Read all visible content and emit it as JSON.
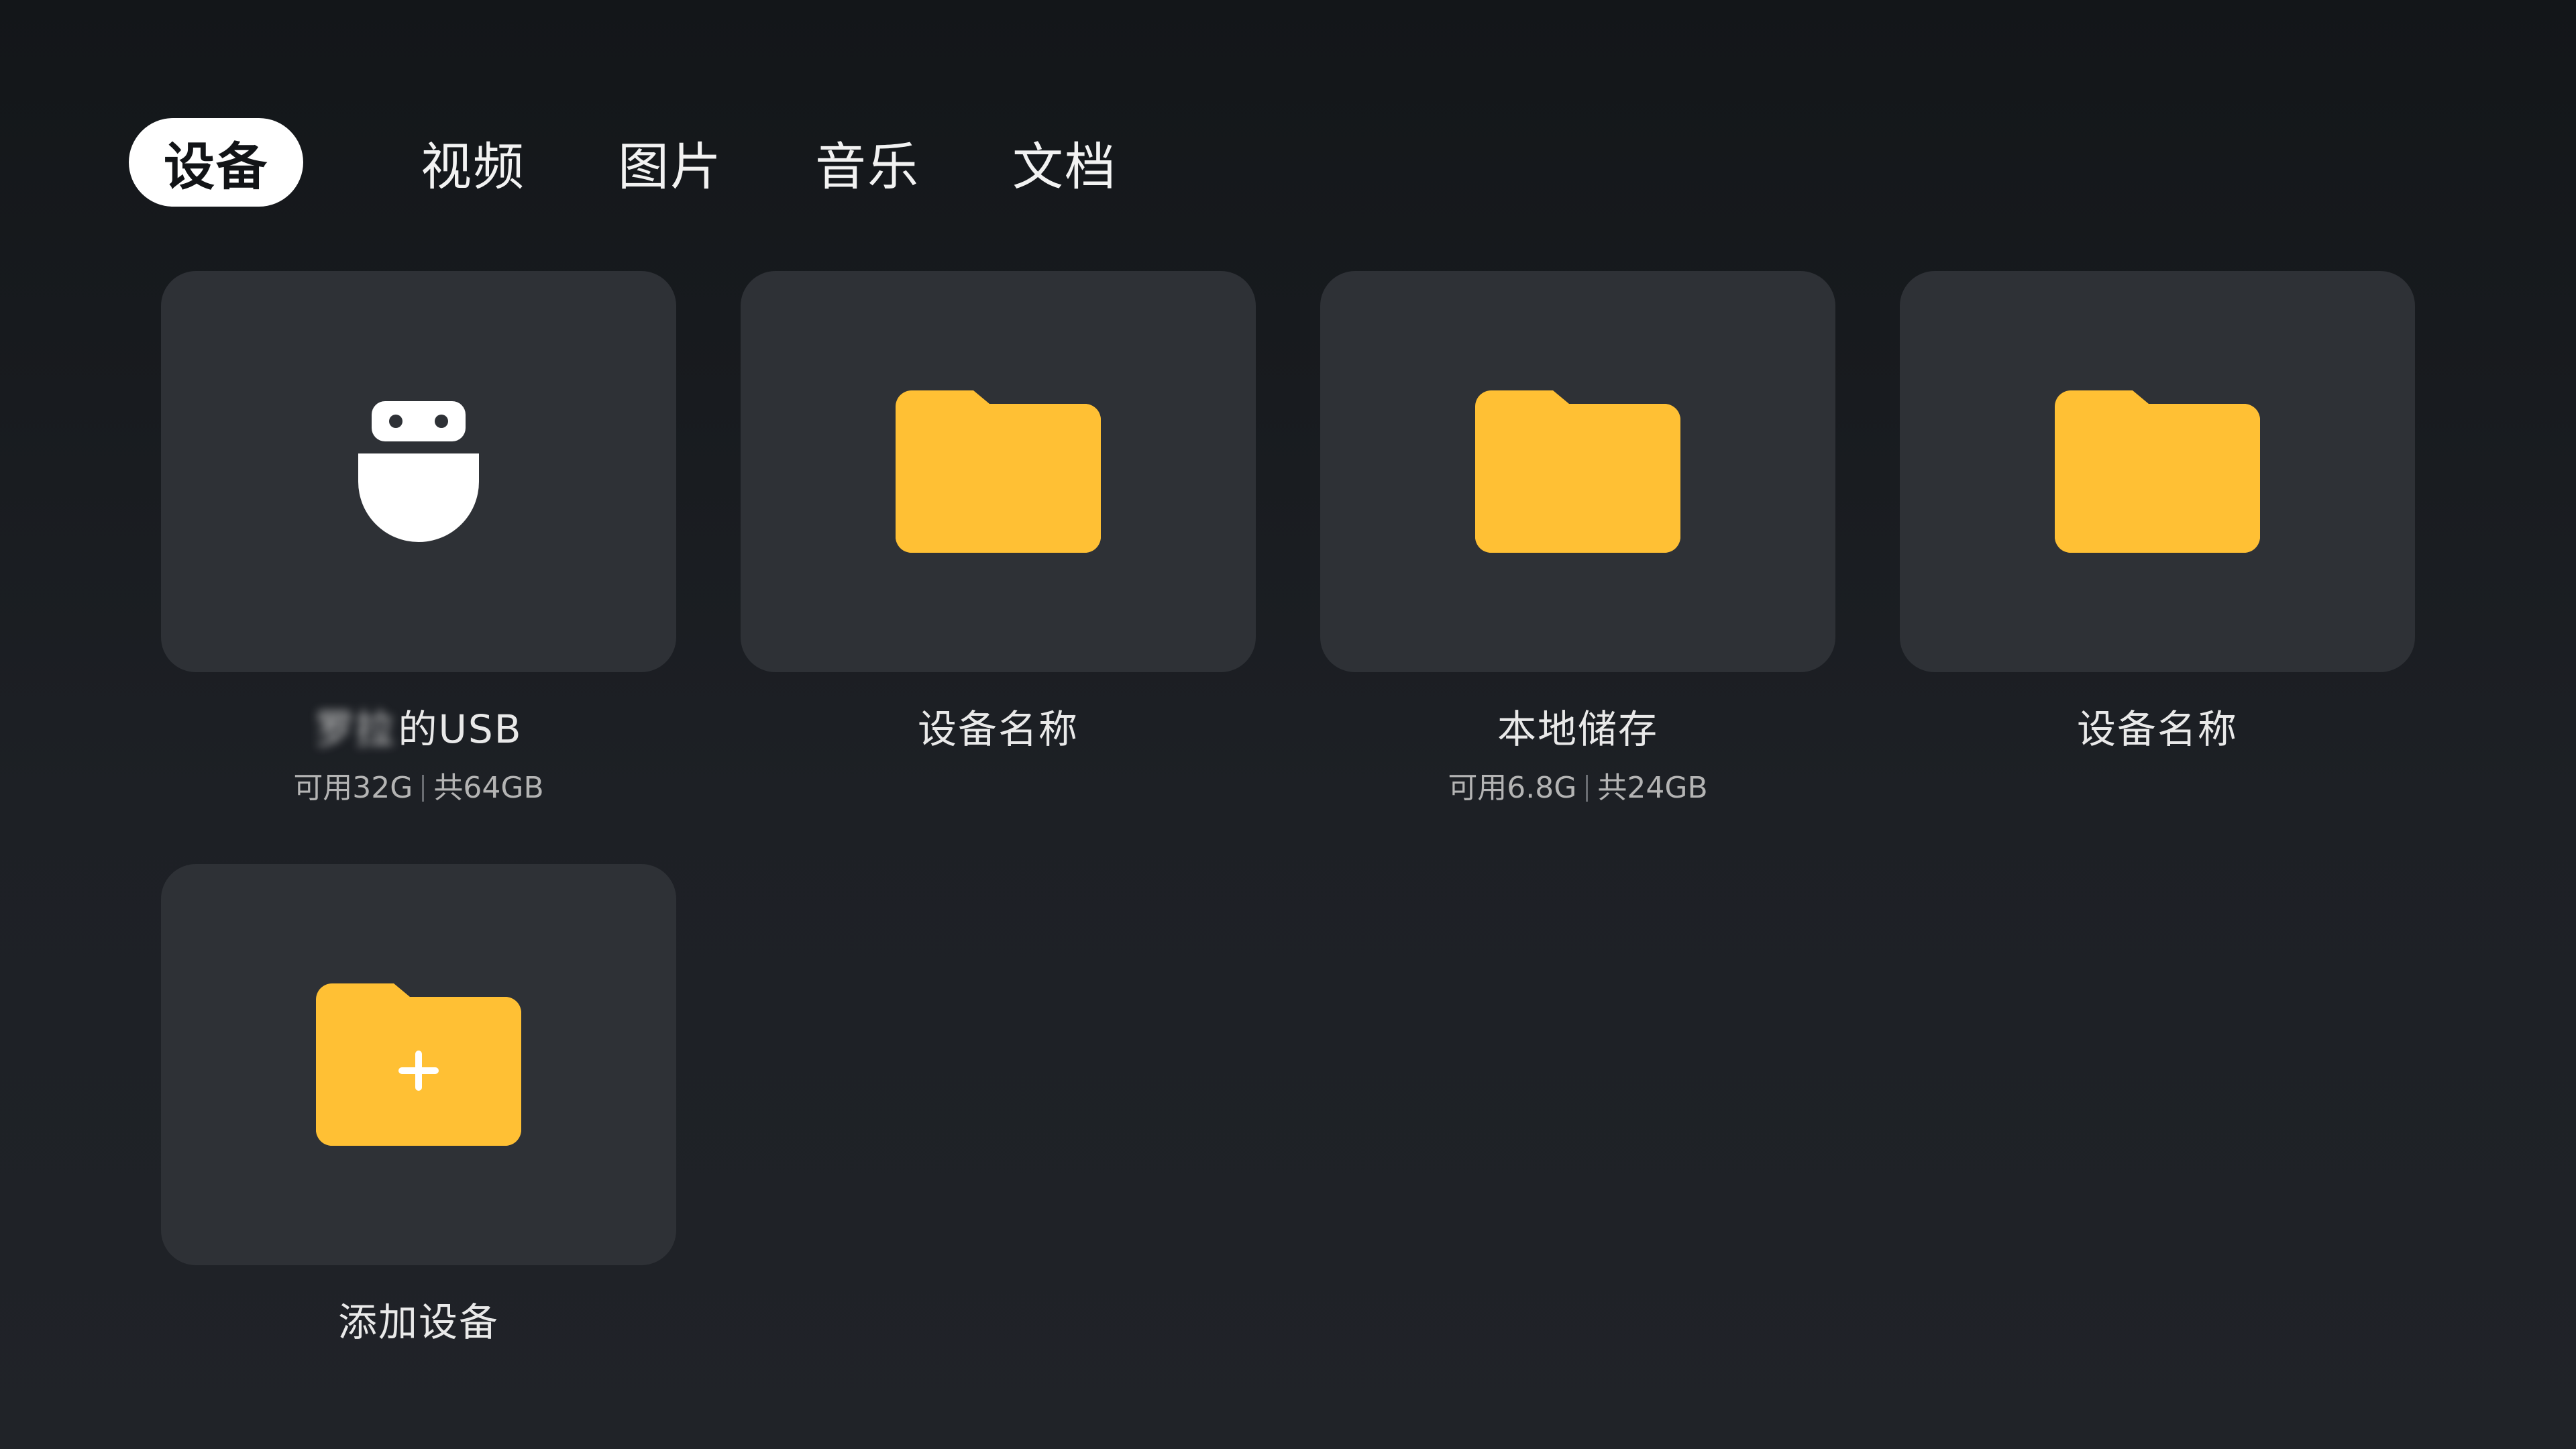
{
  "tabs": [
    {
      "label": "设备",
      "active": true
    },
    {
      "label": "视频"
    },
    {
      "label": "图片"
    },
    {
      "label": "音乐"
    },
    {
      "label": "文档"
    }
  ],
  "devices": [
    {
      "icon": "usb-drive-icon",
      "name_blurred": "罗拉",
      "name": "的USB",
      "available": "可用32G",
      "total": "共64GB"
    },
    {
      "icon": "folder-icon",
      "name": "设备名称"
    },
    {
      "icon": "folder-icon",
      "name": "本地储存",
      "available": "可用6.8G",
      "total": "共24GB"
    },
    {
      "icon": "folder-icon",
      "name": "设备名称"
    }
  ],
  "add_device": {
    "icon": "folder-plus-icon",
    "label": "添加设备"
  },
  "colors": {
    "folder_front": "#ffc034",
    "folder_back": "#f08c1c",
    "tile_bg": "#2e3136",
    "active_tab_bg": "#ffffff"
  }
}
